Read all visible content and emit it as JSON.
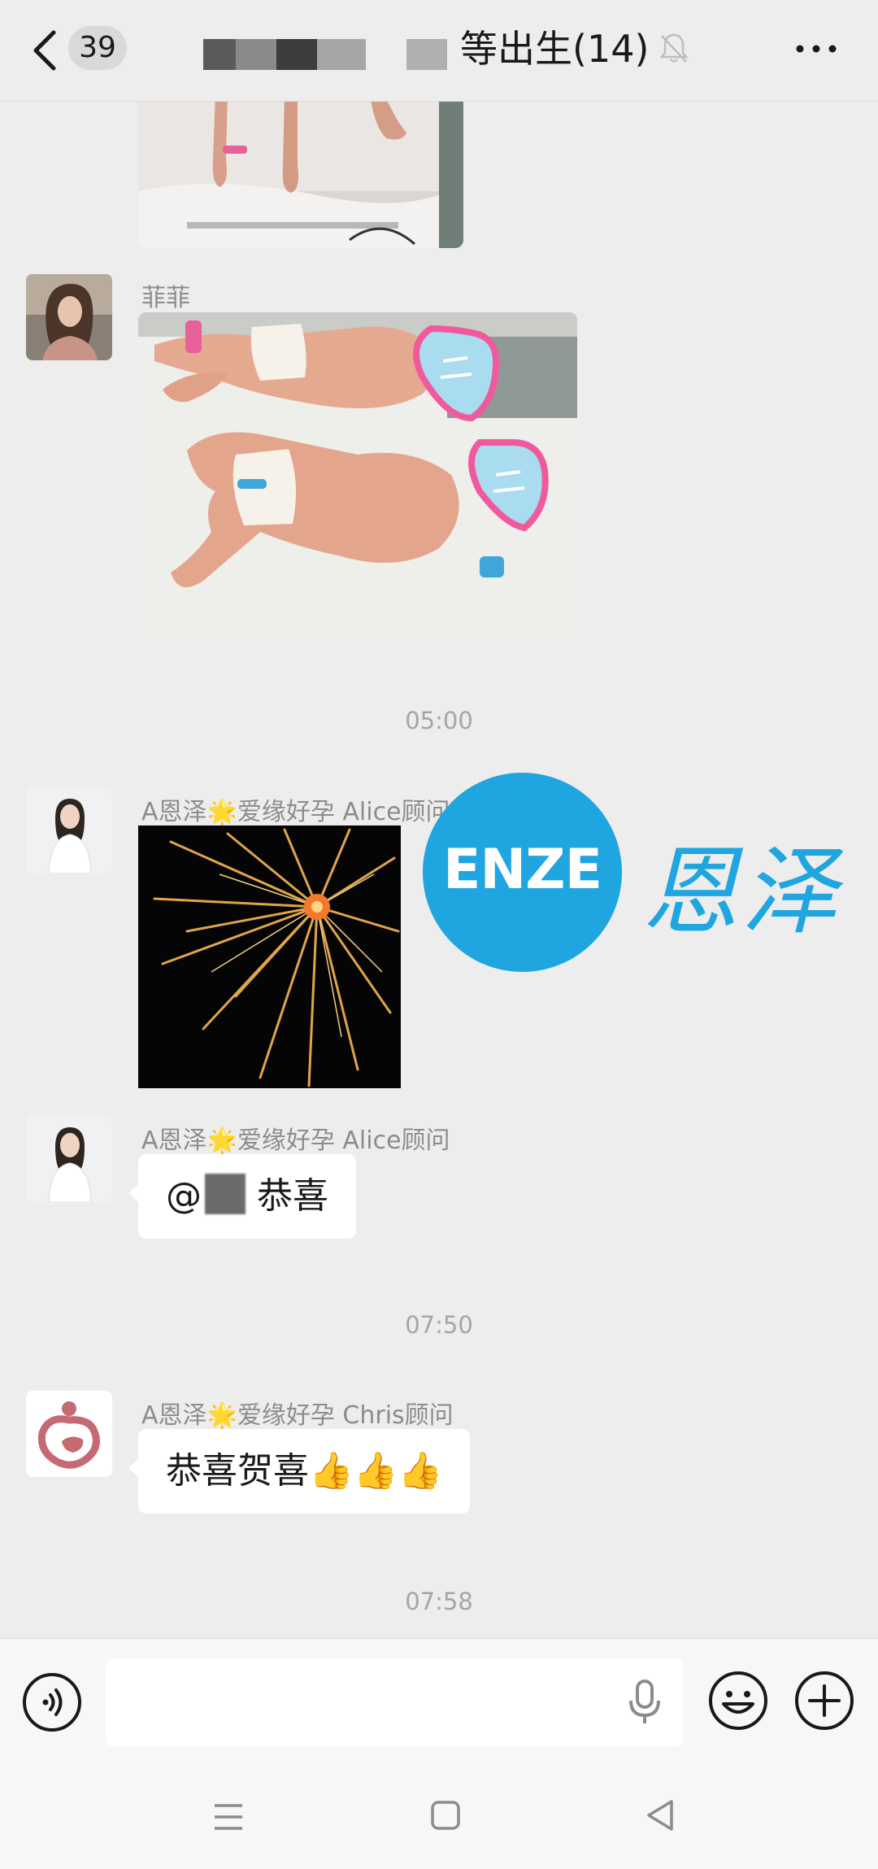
{
  "header": {
    "unread_count": "39",
    "title": "等出生(14)",
    "back_icon": "chevron-left-icon",
    "mute_icon": "bell-off-icon",
    "more_icon": "more-dots-icon"
  },
  "messages": [
    {
      "type": "image",
      "sender": "",
      "image": "newborn-feet-photo"
    },
    {
      "type": "image",
      "sender": "菲菲",
      "image": "newborn-twins-photo"
    },
    {
      "type": "timestamp",
      "text": "05:00"
    },
    {
      "type": "image",
      "sender": "A恩泽🌟爱缘好孕 Alice顾问",
      "image": "fireworks-photo"
    },
    {
      "type": "text",
      "sender": "A恩泽🌟爱缘好孕 Alice顾问",
      "prefix": "@",
      "text": "恭喜"
    },
    {
      "type": "timestamp",
      "text": "07:50"
    },
    {
      "type": "text",
      "sender": "A恩泽🌟爱缘好孕 Chris顾问",
      "text": "恭喜贺喜👍👍👍"
    },
    {
      "type": "timestamp",
      "text": "07:58"
    }
  ],
  "watermark": {
    "logo_text": "ENZE",
    "chinese": "恩泽"
  },
  "input_bar": {
    "voice_icon": "voice-icon",
    "mic_icon": "microphone-icon",
    "emoji_icon": "emoji-icon",
    "plus_icon": "plus-icon",
    "value": ""
  },
  "nav_bar": {
    "menu_icon": "menu-icon",
    "home_icon": "home-icon",
    "back_icon": "back-triangle-icon"
  },
  "colors": {
    "background": "#ededed",
    "bubble": "#ffffff",
    "watermark_blue": "#1fa5e0",
    "muted_text": "#8c8c8c"
  }
}
